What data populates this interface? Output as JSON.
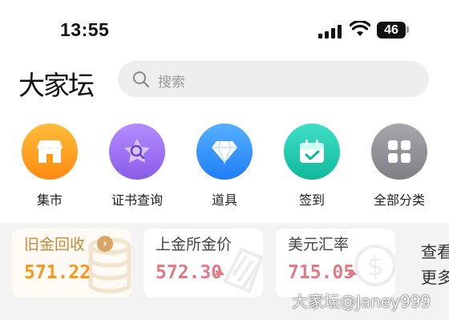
{
  "status_bar": {
    "time": "13:55",
    "battery": "46"
  },
  "header": {
    "logo": "大家坛",
    "search_placeholder": "搜索"
  },
  "categories": [
    {
      "label": "集市",
      "icon": "shop-icon",
      "color": "#ff9a1a"
    },
    {
      "label": "证书查询",
      "icon": "certificate-search-icon",
      "color": "#9a6cf0"
    },
    {
      "label": "道具",
      "icon": "diamond-icon",
      "color": "#2f8cff"
    },
    {
      "label": "签到",
      "icon": "calendar-check-icon",
      "color": "#1ec9b0"
    },
    {
      "label": "全部分类",
      "icon": "grid-icon",
      "color": "#8e8e93"
    }
  ],
  "prices": [
    {
      "title": "旧金回收",
      "value": "571.22",
      "title_color": "#c88a3a",
      "value_color": "#f29a1e"
    },
    {
      "title": "上金所金价",
      "value": "572.30",
      "title_color": "#444444",
      "value_color": "#e07a86"
    },
    {
      "title": "美元汇率",
      "value": "715.05",
      "title_color": "#444444",
      "value_color": "#e07a86"
    }
  ],
  "more": {
    "line1": "查看",
    "line2": "更多"
  },
  "watermark": "大家坛@Janey999"
}
